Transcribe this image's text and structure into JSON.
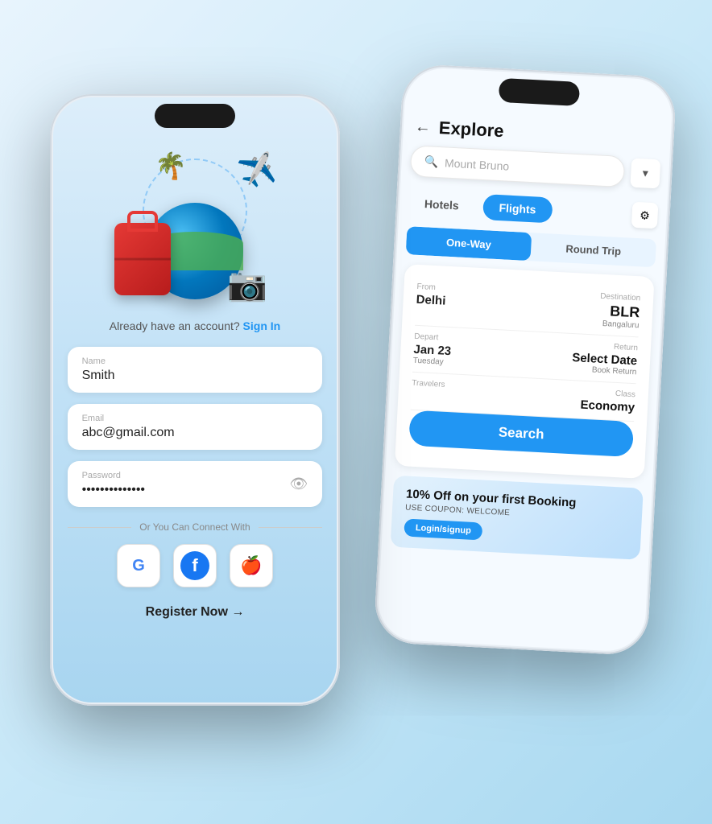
{
  "phone1": {
    "screen": "registration",
    "already_account_text": "Already have an account?",
    "sign_in_label": "Sign In",
    "name_label": "Name",
    "name_value": "Smith",
    "email_label": "Email",
    "email_value": "abc@gmail.com",
    "password_label": "Password",
    "password_value": "••••••••••••••",
    "social_divider": "Or You Can Connect With",
    "google_label": "G",
    "facebook_label": "f",
    "apple_label": "",
    "register_label": "Register Now →"
  },
  "phone2": {
    "screen": "explore",
    "header": {
      "back_label": "←",
      "title": "Explore"
    },
    "search": {
      "placeholder": "Mount Bruno",
      "filter_icon": "▼"
    },
    "tabs": [
      {
        "label": "Hotels",
        "active": false
      },
      {
        "label": "Flights",
        "active": true
      }
    ],
    "trip_types": [
      {
        "label": "One-Way",
        "active": true
      },
      {
        "label": "Round Trip",
        "active": false
      }
    ],
    "booking_fields": [
      {
        "left_label": "From",
        "left_value": "Delhi",
        "right_label": "Destination",
        "right_value": "BLR",
        "right_sub": "Bangaluru"
      },
      {
        "left_label": "Depart",
        "left_value": "Jan 23",
        "left_sub": "Tuesday",
        "right_label": "Return",
        "right_value": "Select Date",
        "right_sub": "Book Return"
      },
      {
        "left_label": "Travelers",
        "left_value": "",
        "right_label": "Class",
        "right_value": "Economy"
      }
    ],
    "search_button_label": "Search",
    "promo": {
      "title": "10% Off on your first Booking",
      "subtitle": "USE COUPON: WELCOME",
      "cta_label": "Login/signup"
    },
    "adjust_icon": "⚙"
  }
}
